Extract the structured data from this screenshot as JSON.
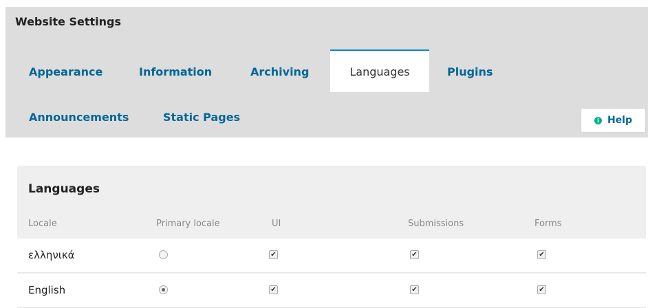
{
  "panel": {
    "title": "Website Settings"
  },
  "tabs": [
    {
      "label": "Appearance"
    },
    {
      "label": "Information"
    },
    {
      "label": "Archiving"
    },
    {
      "label": "Languages",
      "active": true
    },
    {
      "label": "Plugins"
    },
    {
      "label": "Announcements"
    },
    {
      "label": "Static Pages"
    }
  ],
  "help": {
    "label": "Help",
    "icon": "info-circle-icon"
  },
  "languages": {
    "title": "Languages",
    "columns": [
      "Locale",
      "Primary locale",
      "UI",
      "Submissions",
      "Forms"
    ],
    "rows": [
      {
        "locale": "ελληνικά",
        "primary": false,
        "ui": true,
        "submissions": true,
        "forms": true
      },
      {
        "locale": "English",
        "primary": true,
        "ui": true,
        "submissions": true,
        "forms": true
      }
    ]
  },
  "colors": {
    "link": "#006798",
    "active_tab_border": "#008acb",
    "help_icon": "#00b28e"
  }
}
